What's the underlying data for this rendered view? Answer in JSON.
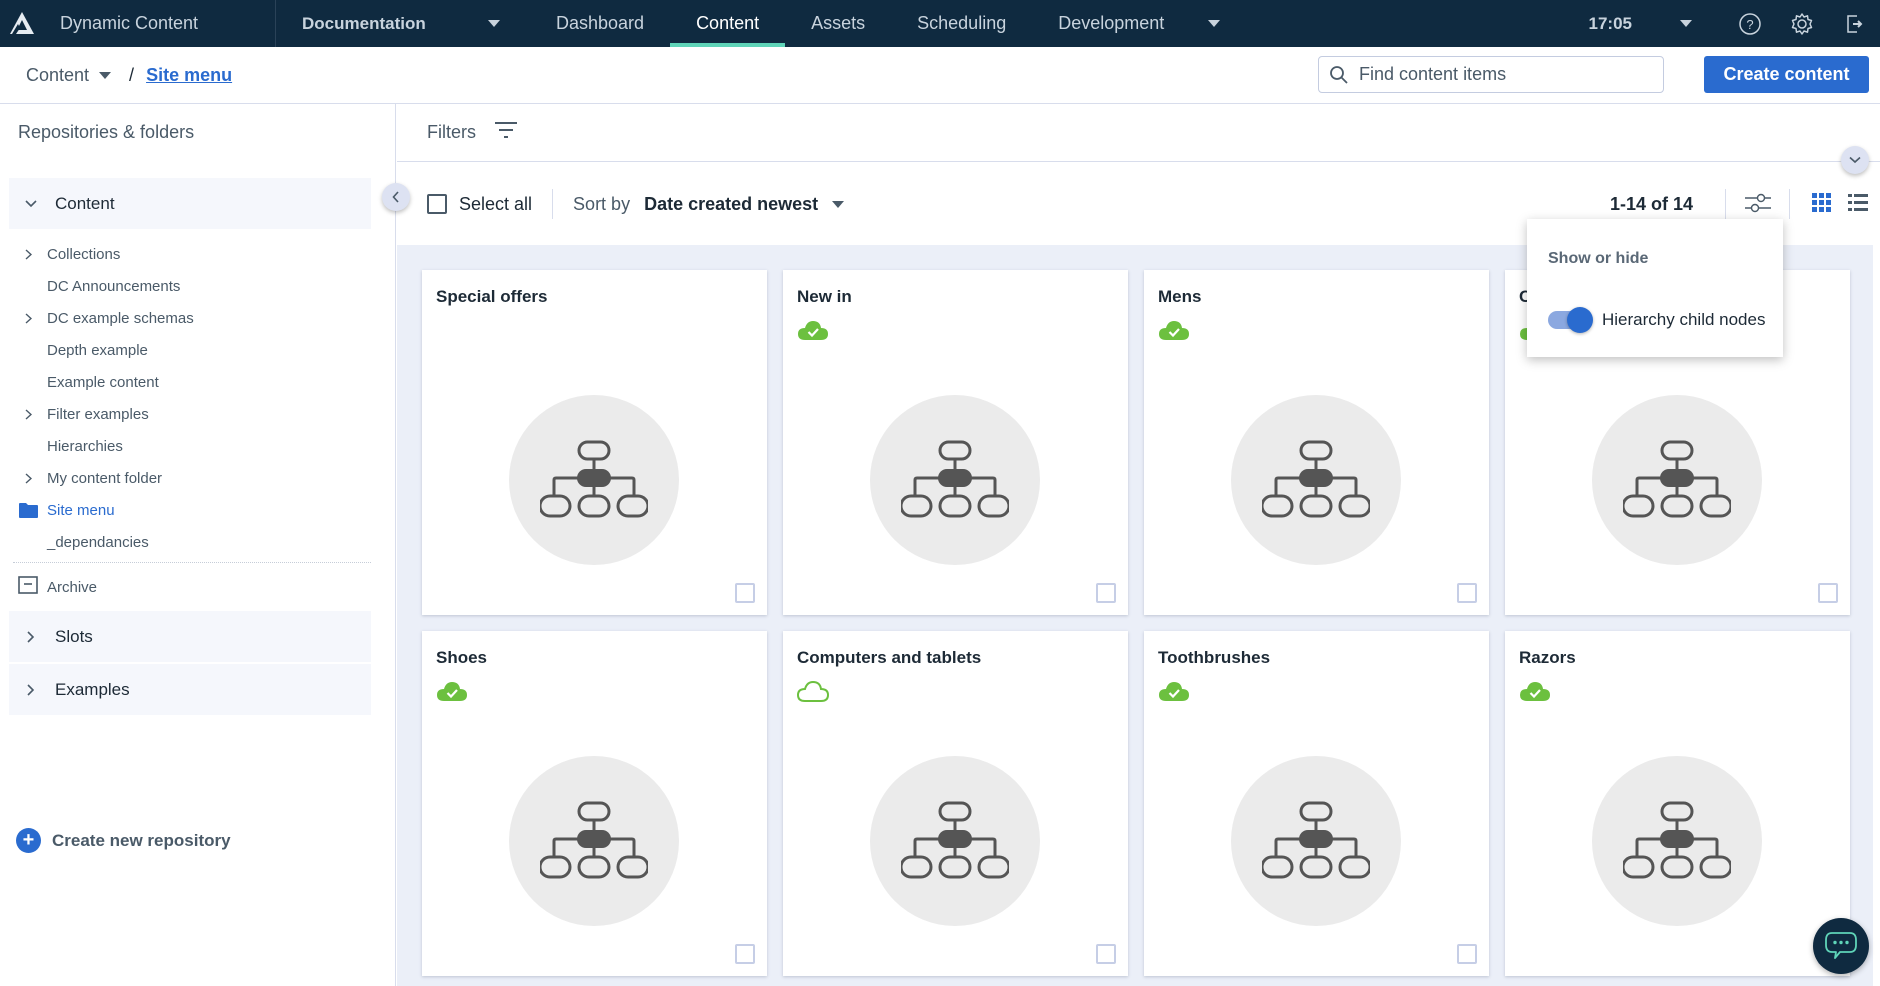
{
  "topnav": {
    "app_name": "Dynamic Content",
    "hub": "Documentation",
    "tabs": [
      {
        "label": "Dashboard",
        "active": false
      },
      {
        "label": "Content",
        "active": true
      },
      {
        "label": "Assets",
        "active": false
      },
      {
        "label": "Scheduling",
        "active": false
      },
      {
        "label": "Development",
        "active": false
      }
    ],
    "time": "17:05",
    "icons": [
      "help-icon",
      "settings-gear-icon",
      "logout-icon"
    ]
  },
  "breadcrumb": {
    "root": "Content",
    "separator": "/",
    "current": "Site menu"
  },
  "search": {
    "placeholder": "Find content items",
    "value": ""
  },
  "create_button": "Create content",
  "sidebar": {
    "title": "Repositories & folders",
    "repositories": [
      {
        "label": "Content",
        "expanded": true
      },
      {
        "label": "Slots",
        "expanded": false
      },
      {
        "label": "Examples",
        "expanded": false
      }
    ],
    "folders": [
      {
        "label": "Collections",
        "has_children": true
      },
      {
        "label": "DC Announcements",
        "has_children": false
      },
      {
        "label": "DC example schemas",
        "has_children": true
      },
      {
        "label": "Depth example",
        "has_children": false
      },
      {
        "label": "Example content",
        "has_children": false
      },
      {
        "label": "Filter examples",
        "has_children": true
      },
      {
        "label": "Hierarchies",
        "has_children": false
      },
      {
        "label": "My content folder",
        "has_children": true
      },
      {
        "label": "Site menu",
        "has_children": false,
        "selected": true
      },
      {
        "label": "_dependancies",
        "has_children": false
      }
    ],
    "archive": "Archive",
    "create_repo": "Create new repository"
  },
  "filters": {
    "label": "Filters"
  },
  "toolbar": {
    "select_all": "Select all",
    "sort_by_label": "Sort by",
    "sort_value": "Date created newest",
    "count": "1-14 of 14",
    "view": "grid"
  },
  "popover": {
    "title": "Show or hide",
    "toggle_label": "Hierarchy child nodes",
    "toggle_on": true
  },
  "cards": [
    {
      "title": "Special offers",
      "status": "none"
    },
    {
      "title": "New in",
      "status": "published"
    },
    {
      "title": "Mens",
      "status": "published"
    },
    {
      "title": "C",
      "status": "published"
    },
    {
      "title": "Shoes",
      "status": "published"
    },
    {
      "title": "Computers and tablets",
      "status": "unpublished"
    },
    {
      "title": "Toothbrushes",
      "status": "published"
    },
    {
      "title": "Razors",
      "status": "published"
    }
  ],
  "colors": {
    "nav_bg": "#0f2a40",
    "accent": "#2a6bcf",
    "active_tab_underline": "#5fd4b8",
    "published_green": "#6cc03f",
    "grid_bg": "#ebeff8"
  }
}
